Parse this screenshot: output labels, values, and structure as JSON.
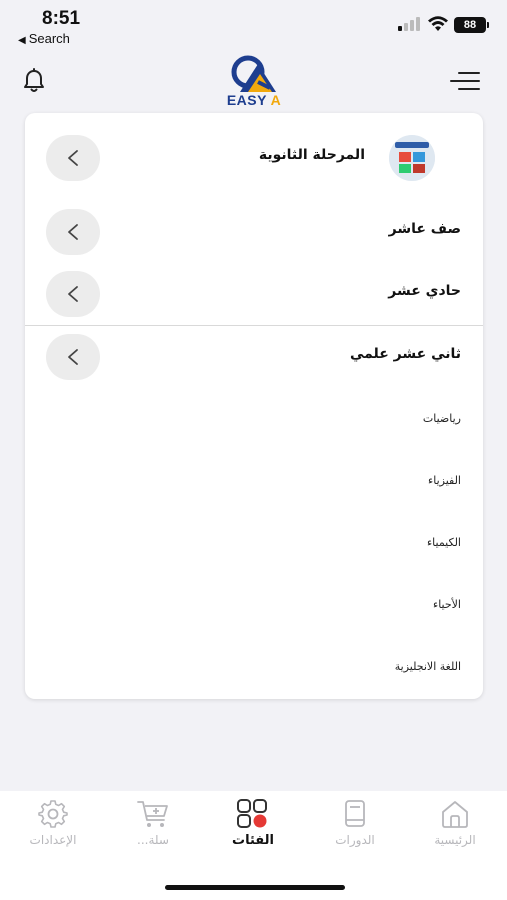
{
  "status_bar": {
    "time": "8:51",
    "back_label": "Search",
    "battery": "88"
  },
  "header": {
    "logo_text_main": "EASY",
    "logo_text_accent": "A",
    "brand_colors": {
      "navy": "#1e3e8f",
      "gold": "#f2a90d"
    },
    "left_icon": "bell-icon",
    "right_icon": "menu-icon"
  },
  "category": {
    "stage_label": "المرحلة الثانوية",
    "rows": [
      {
        "label": "صف عاشر"
      },
      {
        "label": "حادي عشر"
      },
      {
        "label": "ثاني عشر علمي"
      }
    ],
    "subjects": [
      "رياضيات",
      "الفيزياء",
      "الكيمياء",
      "الأحياء",
      "اللغة الانجليزية"
    ]
  },
  "bottom_nav": {
    "items": [
      {
        "label": "الإعدادات",
        "icon": "gear-icon"
      },
      {
        "label": "سلة...",
        "icon": "cart-icon"
      },
      {
        "label": "الفئات",
        "icon": "categories-icon",
        "active": true
      },
      {
        "label": "الدورات",
        "icon": "book-icon"
      },
      {
        "label": "الرئيسية",
        "icon": "home-icon"
      }
    ],
    "active_color": "#e53935"
  }
}
